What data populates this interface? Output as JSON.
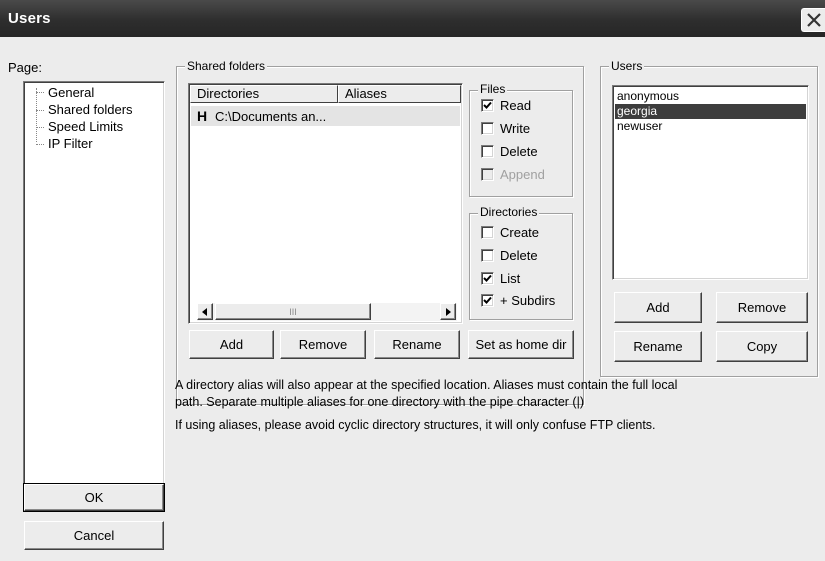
{
  "window": {
    "title": "Users"
  },
  "page_label": "Page:",
  "tree": {
    "items": [
      {
        "label": "General"
      },
      {
        "label": "Shared folders"
      },
      {
        "label": "Speed Limits"
      },
      {
        "label": "IP Filter"
      }
    ]
  },
  "shared_folders": {
    "group_label": "Shared folders",
    "columns": [
      "Directories",
      "Aliases"
    ],
    "rows": [
      {
        "marker": "H",
        "directory": "C:\\Documents an...",
        "alias": ""
      }
    ],
    "scrollbar_grip": "III",
    "buttons": {
      "add": "Add",
      "remove": "Remove",
      "rename": "Rename",
      "set_home": "Set as home dir"
    }
  },
  "files": {
    "group_label": "Files",
    "options": [
      {
        "label": "Read",
        "checked": true,
        "enabled": true
      },
      {
        "label": "Write",
        "checked": false,
        "enabled": true
      },
      {
        "label": "Delete",
        "checked": false,
        "enabled": true
      },
      {
        "label": "Append",
        "checked": false,
        "enabled": false
      }
    ]
  },
  "directories": {
    "group_label": "Directories",
    "options": [
      {
        "label": "Create",
        "checked": false,
        "enabled": true
      },
      {
        "label": "Delete",
        "checked": false,
        "enabled": true
      },
      {
        "label": "List",
        "checked": true,
        "enabled": true
      },
      {
        "label": "+ Subdirs",
        "checked": true,
        "enabled": true
      }
    ]
  },
  "users": {
    "group_label": "Users",
    "list": [
      "anonymous",
      "georgia",
      "newuser"
    ],
    "selected": "georgia",
    "buttons": {
      "add": "Add",
      "remove": "Remove",
      "rename": "Rename",
      "copy": "Copy"
    }
  },
  "info": {
    "line1": "A directory alias will also appear at the specified location. Aliases must contain the full local",
    "line2": "path. Separate multiple aliases for one directory with the pipe character (|)",
    "line3": "If using aliases, please avoid cyclic directory structures, it will only confuse FTP clients."
  },
  "dialog_buttons": {
    "ok": "OK",
    "cancel": "Cancel"
  }
}
